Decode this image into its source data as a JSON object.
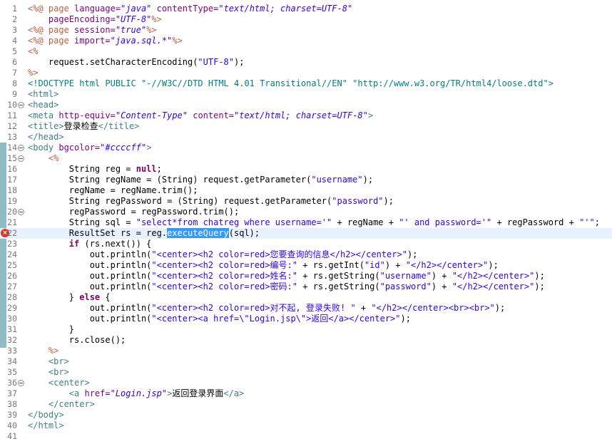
{
  "editor": {
    "current_line": 22,
    "error_line": 22,
    "lines": [
      {
        "n": "1",
        "tokens": [
          {
            "t": "<%@ ",
            "c": "dir"
          },
          {
            "t": "page ",
            "c": "dir"
          },
          {
            "t": "language=",
            "c": "attr"
          },
          {
            "t": "\"java\"",
            "c": "val"
          },
          {
            "t": " contentType=",
            "c": "attr"
          },
          {
            "t": "\"text/html; charset=UTF-8\"",
            "c": "val"
          }
        ]
      },
      {
        "n": "2",
        "tokens": [
          {
            "t": "    pageEncoding=",
            "c": "attr"
          },
          {
            "t": "\"UTF-8\"",
            "c": "val"
          },
          {
            "t": "%>",
            "c": "dir"
          }
        ]
      },
      {
        "n": "3",
        "tokens": [
          {
            "t": "<%@ ",
            "c": "dir"
          },
          {
            "t": "page ",
            "c": "dir"
          },
          {
            "t": "session=",
            "c": "attr"
          },
          {
            "t": "\"true\"",
            "c": "val"
          },
          {
            "t": "%>",
            "c": "dir"
          }
        ]
      },
      {
        "n": "4",
        "tokens": [
          {
            "t": "<%@ ",
            "c": "dir"
          },
          {
            "t": "page ",
            "c": "dir"
          },
          {
            "t": "import=",
            "c": "attr"
          },
          {
            "t": "\"java.sql.*\"",
            "c": "val"
          },
          {
            "t": "%>",
            "c": "dir"
          }
        ]
      },
      {
        "n": "5",
        "tokens": [
          {
            "t": "<%",
            "c": "dir"
          }
        ]
      },
      {
        "n": "6",
        "tokens": [
          {
            "t": "    request.setCharacterEncoding(",
            "c": "plain"
          },
          {
            "t": "\"UTF-8\"",
            "c": "str"
          },
          {
            "t": ");",
            "c": "plain"
          }
        ]
      },
      {
        "n": "7",
        "tokens": [
          {
            "t": "%>",
            "c": "dir"
          }
        ]
      },
      {
        "n": "8",
        "tokens": [
          {
            "t": "<!DOCTYPE ",
            "c": "doc"
          },
          {
            "t": "html ",
            "c": "doc"
          },
          {
            "t": "PUBLIC ",
            "c": "doc"
          },
          {
            "t": "\"-//W3C//DTD HTML 4.01 Transitional//EN\" \"http://www.w3.org/TR/html4/loose.dtd\"",
            "c": "doc"
          },
          {
            "t": ">",
            "c": "doc"
          }
        ]
      },
      {
        "n": "9",
        "tokens": [
          {
            "t": "<html>",
            "c": "tag"
          }
        ]
      },
      {
        "n": "10",
        "fold": true,
        "tokens": [
          {
            "t": "<head>",
            "c": "tag"
          }
        ]
      },
      {
        "n": "11",
        "tokens": [
          {
            "t": "<meta ",
            "c": "tag"
          },
          {
            "t": "http-equiv=",
            "c": "attr"
          },
          {
            "t": "\"Content-Type\"",
            "c": "val"
          },
          {
            "t": " content=",
            "c": "attr"
          },
          {
            "t": "\"text/html; charset=UTF-8\"",
            "c": "val"
          },
          {
            "t": ">",
            "c": "tag"
          }
        ]
      },
      {
        "n": "12",
        "tokens": [
          {
            "t": "<title>",
            "c": "tag"
          },
          {
            "t": "登录检查",
            "c": "plain"
          },
          {
            "t": "</title>",
            "c": "tag"
          }
        ]
      },
      {
        "n": "13",
        "tokens": [
          {
            "t": "</head>",
            "c": "tag"
          }
        ]
      },
      {
        "n": "14",
        "fold": true,
        "tokens": [
          {
            "t": "<body ",
            "c": "tag"
          },
          {
            "t": "bgcolor=",
            "c": "attr"
          },
          {
            "t": "\"#ccccff\"",
            "c": "val"
          },
          {
            "t": ">",
            "c": "tag"
          }
        ]
      },
      {
        "n": "15",
        "fold": true,
        "tokens": [
          {
            "t": "    ",
            "c": "plain"
          },
          {
            "t": "<%",
            "c": "dir"
          }
        ]
      },
      {
        "n": "16",
        "tokens": [
          {
            "t": "        String reg = ",
            "c": "plain"
          },
          {
            "t": "null",
            "c": "kw"
          },
          {
            "t": ";",
            "c": "plain"
          }
        ]
      },
      {
        "n": "17",
        "tokens": [
          {
            "t": "        String regName = (String) request.getParameter(",
            "c": "plain"
          },
          {
            "t": "\"username\"",
            "c": "str"
          },
          {
            "t": ");",
            "c": "plain"
          }
        ]
      },
      {
        "n": "18",
        "tokens": [
          {
            "t": "        regName = regName.trim();",
            "c": "plain"
          }
        ]
      },
      {
        "n": "19",
        "tokens": [
          {
            "t": "        String regPassword = (String) request.getParameter(",
            "c": "plain"
          },
          {
            "t": "\"password\"",
            "c": "str"
          },
          {
            "t": ");",
            "c": "plain"
          }
        ]
      },
      {
        "n": "20",
        "fold": true,
        "tokens": [
          {
            "t": "        regPassword = regPassword.trim();",
            "c": "plain"
          }
        ]
      },
      {
        "n": "21",
        "tokens": [
          {
            "t": "        String sql = ",
            "c": "plain"
          },
          {
            "t": "\"select*from chatreg where username='\"",
            "c": "str"
          },
          {
            "t": " + regName + ",
            "c": "plain"
          },
          {
            "t": "\"' and password='\"",
            "c": "str"
          },
          {
            "t": " + regPassword + ",
            "c": "plain"
          },
          {
            "t": "\"'\"",
            "c": "str"
          },
          {
            "t": ";",
            "c": "plain"
          }
        ]
      },
      {
        "n": "22",
        "error": true,
        "tokens": [
          {
            "t": "        ResultSet rs = reg.",
            "c": "plain"
          },
          {
            "t": "executeQuery",
            "c": "sel"
          },
          {
            "t": "(sql);",
            "c": "plain"
          }
        ]
      },
      {
        "n": "23",
        "tokens": [
          {
            "t": "        ",
            "c": "plain"
          },
          {
            "t": "if",
            "c": "kw"
          },
          {
            "t": " (rs.next()) {",
            "c": "plain"
          }
        ]
      },
      {
        "n": "24",
        "tokens": [
          {
            "t": "            out.println(",
            "c": "plain"
          },
          {
            "t": "\"<center><h2 color=red>您要查询的信息</h2></center>\"",
            "c": "str"
          },
          {
            "t": ");",
            "c": "plain"
          }
        ]
      },
      {
        "n": "25",
        "tokens": [
          {
            "t": "            out.println(",
            "c": "plain"
          },
          {
            "t": "\"<center><h2 color=red>编号:\"",
            "c": "str"
          },
          {
            "t": " + rs.getInt(",
            "c": "plain"
          },
          {
            "t": "\"id\"",
            "c": "str"
          },
          {
            "t": ") + ",
            "c": "plain"
          },
          {
            "t": "\"</h2></center>\"",
            "c": "str"
          },
          {
            "t": ");",
            "c": "plain"
          }
        ]
      },
      {
        "n": "26",
        "tokens": [
          {
            "t": "            out.println(",
            "c": "plain"
          },
          {
            "t": "\"<center><h2 color=red>姓名:\"",
            "c": "str"
          },
          {
            "t": " + rs.getString(",
            "c": "plain"
          },
          {
            "t": "\"username\"",
            "c": "str"
          },
          {
            "t": ") + ",
            "c": "plain"
          },
          {
            "t": "\"</h2></center>\"",
            "c": "str"
          },
          {
            "t": ");",
            "c": "plain"
          }
        ]
      },
      {
        "n": "27",
        "tokens": [
          {
            "t": "            out.println(",
            "c": "plain"
          },
          {
            "t": "\"<center><h2 color=red>密码:\"",
            "c": "str"
          },
          {
            "t": " + rs.getString(",
            "c": "plain"
          },
          {
            "t": "\"password\"",
            "c": "str"
          },
          {
            "t": ") + ",
            "c": "plain"
          },
          {
            "t": "\"</h2></center>\"",
            "c": "str"
          },
          {
            "t": ");",
            "c": "plain"
          }
        ]
      },
      {
        "n": "28",
        "tokens": [
          {
            "t": "        } ",
            "c": "plain"
          },
          {
            "t": "else",
            "c": "kw"
          },
          {
            "t": " {",
            "c": "plain"
          }
        ]
      },
      {
        "n": "29",
        "tokens": [
          {
            "t": "            out.println(",
            "c": "plain"
          },
          {
            "t": "\"<center><h2 color=red>对不起, 登录失败! \"",
            "c": "str"
          },
          {
            "t": " + ",
            "c": "plain"
          },
          {
            "t": "\"</h2></center><br><br>\"",
            "c": "str"
          },
          {
            "t": ");",
            "c": "plain"
          }
        ]
      },
      {
        "n": "30",
        "tokens": [
          {
            "t": "            out.println(",
            "c": "plain"
          },
          {
            "t": "\"<center><a href=\\\"Login.jsp\\\">返回</a></center>\"",
            "c": "str"
          },
          {
            "t": ");",
            "c": "plain"
          }
        ]
      },
      {
        "n": "31",
        "tokens": [
          {
            "t": "        }",
            "c": "plain"
          }
        ]
      },
      {
        "n": "32",
        "tokens": [
          {
            "t": "        rs.close();",
            "c": "plain"
          }
        ]
      },
      {
        "n": "33",
        "tokens": [
          {
            "t": "    ",
            "c": "plain"
          },
          {
            "t": "%>",
            "c": "dir"
          }
        ]
      },
      {
        "n": "34",
        "tokens": [
          {
            "t": "    ",
            "c": "plain"
          },
          {
            "t": "<br>",
            "c": "tag"
          }
        ]
      },
      {
        "n": "35",
        "tokens": [
          {
            "t": "    ",
            "c": "plain"
          },
          {
            "t": "<br>",
            "c": "tag"
          }
        ]
      },
      {
        "n": "36",
        "fold": true,
        "tokens": [
          {
            "t": "    ",
            "c": "plain"
          },
          {
            "t": "<center>",
            "c": "tag"
          }
        ]
      },
      {
        "n": "37",
        "tokens": [
          {
            "t": "        ",
            "c": "plain"
          },
          {
            "t": "<a ",
            "c": "tag"
          },
          {
            "t": "href=",
            "c": "attr"
          },
          {
            "t": "\"Login.jsp\"",
            "c": "val"
          },
          {
            "t": ">",
            "c": "tag"
          },
          {
            "t": "返回登录界面",
            "c": "plain"
          },
          {
            "t": "</a>",
            "c": "tag"
          }
        ]
      },
      {
        "n": "38",
        "tokens": [
          {
            "t": "    ",
            "c": "plain"
          },
          {
            "t": "</center>",
            "c": "tag"
          }
        ]
      },
      {
        "n": "39",
        "tokens": [
          {
            "t": "</body>",
            "c": "tag"
          }
        ]
      },
      {
        "n": "40",
        "tokens": [
          {
            "t": "</html>",
            "c": "tag"
          }
        ]
      },
      {
        "n": "41",
        "tokens": []
      }
    ]
  },
  "colors": {
    "directive": "#bf5f3f",
    "attribute": "#7f007f",
    "value": "#2a00ff",
    "tag": "#3f7f7f",
    "keyword": "#7f0055",
    "current_line_bg": "#e8f2fe",
    "selection_bg": "#3399ff",
    "change_bar": "#8ebbc8",
    "error_icon": "#d23a2b"
  },
  "icons": {
    "error_marker": "error-icon",
    "fold_marker": "fold-toggle-icon"
  }
}
